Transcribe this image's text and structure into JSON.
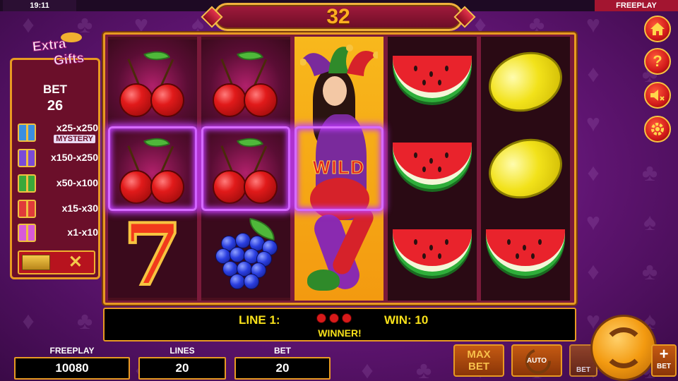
{
  "status_bar": {
    "time": "19:11",
    "mode": "FREEPLAY"
  },
  "counter": {
    "value": "32"
  },
  "extra_gifts": {
    "logo_line1": "Extra",
    "logo_line2": "Gifts",
    "bet_label": "BET",
    "bet_value": "26",
    "rows": [
      {
        "range": "x25-x250",
        "note": "MYSTERY",
        "color": "#3a8ee0"
      },
      {
        "range": "x150-x250",
        "color": "#7a4bd8"
      },
      {
        "range": "x50-x100",
        "color": "#3aa83a"
      },
      {
        "range": "x15-x30",
        "color": "#e03a3a"
      },
      {
        "range": "x1-x10",
        "color": "#d85ad8"
      }
    ],
    "toggle_symbol": "✕"
  },
  "reels": [
    [
      "cherry",
      "cherry",
      "seven"
    ],
    [
      "cherry",
      "cherry",
      "grapes"
    ],
    [
      "wild",
      "wild",
      "wild"
    ],
    [
      "watermelon",
      "watermelon",
      "watermelon"
    ],
    [
      "lemon",
      "lemon",
      "watermelon"
    ]
  ],
  "wild_label": "WILD",
  "win_info": {
    "line_label": "LINE 1:",
    "win_label": "WIN: 10",
    "message": "WINNER!"
  },
  "bottom": {
    "freeplay_label": "FREEPLAY",
    "freeplay_value": "10080",
    "lines_label": "LINES",
    "lines_value": "20",
    "bet_label": "BET",
    "bet_value": "20",
    "max_bet_line1": "MAX",
    "max_bet_line2": "BET",
    "auto_label": "AUTO",
    "bet_minus_label": "BET",
    "bet_plus_label": "BET",
    "plus_symbol": "+"
  },
  "side_icons": [
    "home-icon",
    "help-icon",
    "sound-off-icon",
    "settings-icon"
  ],
  "colors": {
    "accent": "#e89a22",
    "counter_text": "#ffb020",
    "win_text": "#f7e01a",
    "highlight": "#d66bff"
  }
}
